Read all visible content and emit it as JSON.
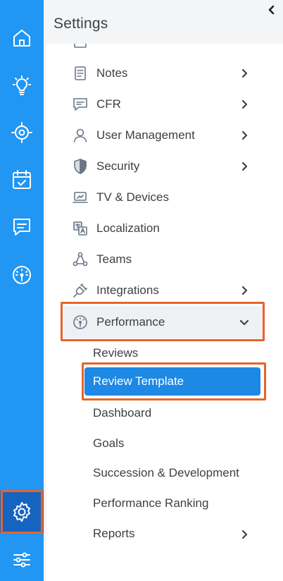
{
  "panel": {
    "title": "Settings"
  },
  "rail": {
    "items": [
      {
        "icon": "home-icon"
      },
      {
        "icon": "lightbulb-icon"
      },
      {
        "icon": "target-icon"
      },
      {
        "icon": "calendar-check-icon"
      },
      {
        "icon": "chat-icon"
      },
      {
        "icon": "gauge-icon"
      },
      {
        "icon": "gear-icon",
        "active": true
      },
      {
        "icon": "sliders-icon"
      }
    ]
  },
  "menu": {
    "items": [
      {
        "label": "Notes",
        "icon": "notes-icon",
        "has_children": true
      },
      {
        "label": "CFR",
        "icon": "cfr-chat-icon",
        "has_children": true
      },
      {
        "label": "User Management",
        "icon": "user-icon",
        "has_children": true
      },
      {
        "label": "Security",
        "icon": "shield-icon",
        "has_children": true
      },
      {
        "label": "TV & Devices",
        "icon": "laptop-icon",
        "has_children": false
      },
      {
        "label": "Localization",
        "icon": "translate-icon",
        "has_children": false
      },
      {
        "label": "Teams",
        "icon": "teams-icon",
        "has_children": false
      },
      {
        "label": "Integrations",
        "icon": "plug-icon",
        "has_children": true
      },
      {
        "label": "Performance",
        "icon": "gauge-icon",
        "has_children": true,
        "expanded": true
      }
    ],
    "performance_children": [
      {
        "label": "Reviews"
      },
      {
        "label": "Review Template",
        "active": true
      },
      {
        "label": "Dashboard"
      },
      {
        "label": "Goals"
      },
      {
        "label": "Succession & Development"
      },
      {
        "label": "Performance Ranking"
      },
      {
        "label": "Reports",
        "has_children": true
      }
    ]
  },
  "colors": {
    "rail_bg": "#2196f3",
    "active_item_bg": "#1e88e5",
    "highlight_outline": "#e8632b"
  }
}
